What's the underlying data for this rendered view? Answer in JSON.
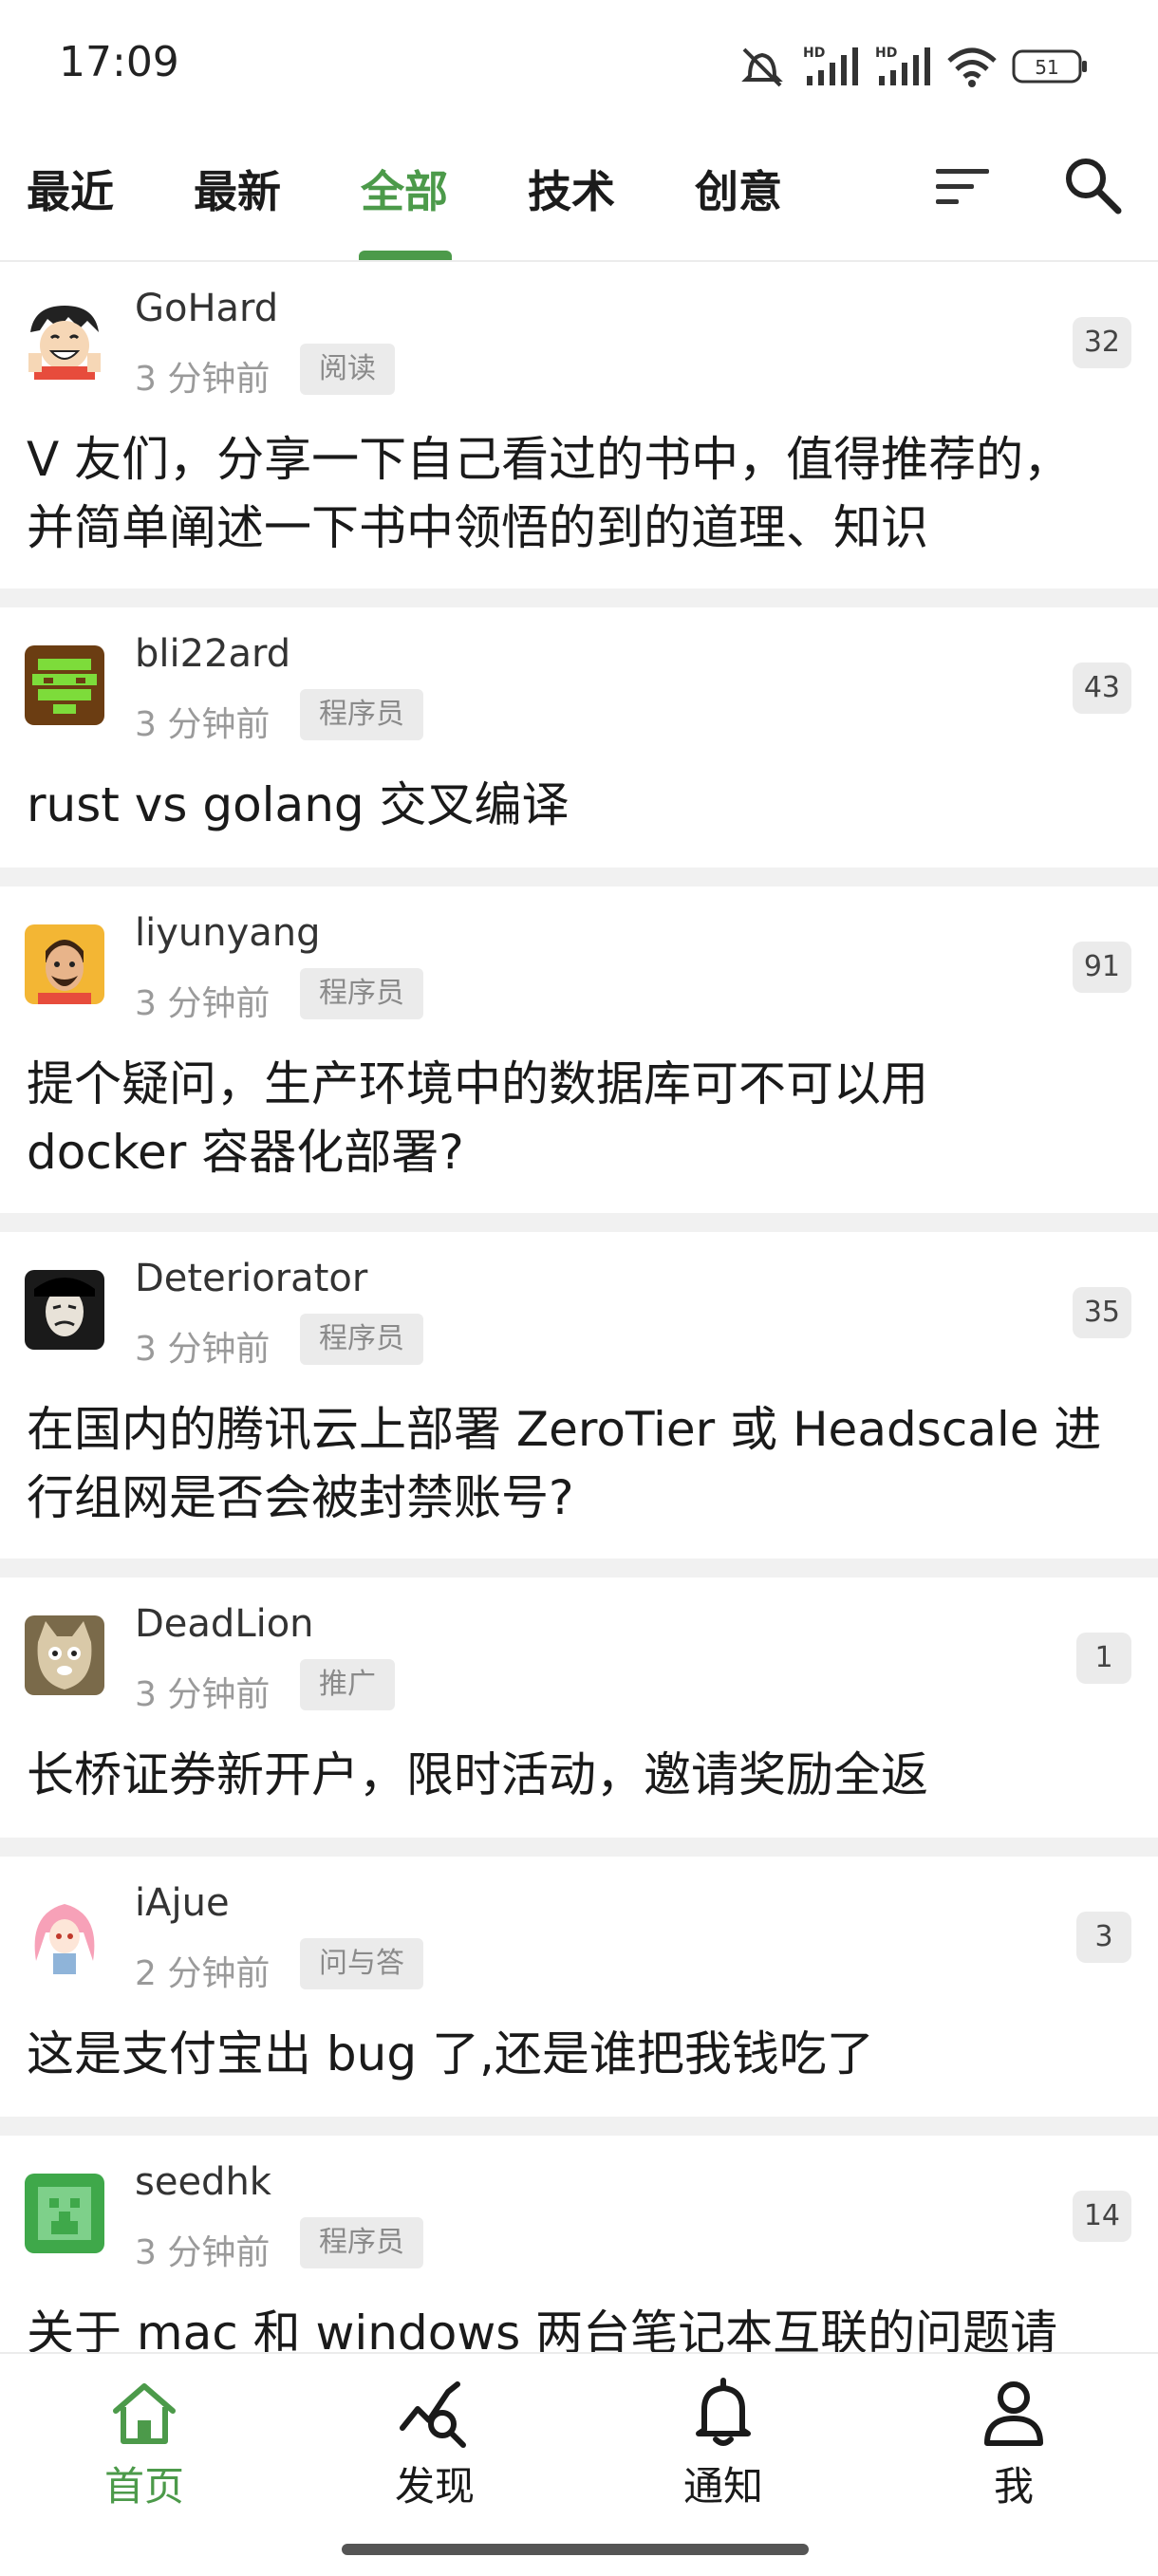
{
  "status_bar": {
    "time": "17:09",
    "battery": "51"
  },
  "tabs": [
    {
      "label": "最近",
      "active": false
    },
    {
      "label": "最新",
      "active": false
    },
    {
      "label": "全部",
      "active": true
    },
    {
      "label": "技术",
      "active": false
    },
    {
      "label": "创意",
      "active": false
    }
  ],
  "header_icons": {
    "sort": "sort-icon",
    "search": "search-icon"
  },
  "topics": [
    {
      "username": "GoHard",
      "time": "3 分钟前",
      "node": "阅读",
      "replies": "32",
      "title_lines": [
        "V 友们，分享一下自己看过的书中，值得推荐的，",
        "并简单阐述一下书中领悟的到的道理、知识"
      ]
    },
    {
      "username": "bli22ard",
      "time": "3 分钟前",
      "node": "程序员",
      "replies": "43",
      "title_lines": [
        "rust vs golang 交叉编译"
      ]
    },
    {
      "username": "liyunyang",
      "time": "3 分钟前",
      "node": "程序员",
      "replies": "91",
      "title_lines": [
        "提个疑问，生产环境中的数据库可不可以用",
        "docker 容器化部署?"
      ]
    },
    {
      "username": "Deteriorator",
      "time": "3 分钟前",
      "node": "程序员",
      "replies": "35",
      "title_lines": [
        "在国内的腾讯云上部署 ZeroTier 或 Headscale 进",
        "行组网是否会被封禁账号?"
      ]
    },
    {
      "username": "DeadLion",
      "time": "3 分钟前",
      "node": "推广",
      "replies": "1",
      "title_lines": [
        "长桥证券新开户，限时活动，邀请奖励全返"
      ]
    },
    {
      "username": "iAjue",
      "time": "2 分钟前",
      "node": "问与答",
      "replies": "3",
      "title_lines": [
        "这是支付宝出 bug 了,还是谁把我钱吃了"
      ]
    },
    {
      "username": "seedhk",
      "time": "3 分钟前",
      "node": "程序员",
      "replies": "14",
      "title_lines": [
        "关于 mac 和 windows 两台笔记本互联的问题请"
      ]
    }
  ],
  "bottom_nav": [
    {
      "label": "首页",
      "icon": "home-icon",
      "active": true
    },
    {
      "label": "发现",
      "icon": "discover-icon",
      "active": false
    },
    {
      "label": "通知",
      "icon": "bell-icon",
      "active": false
    },
    {
      "label": "我",
      "icon": "person-icon",
      "active": false
    }
  ],
  "colors": {
    "accent": "#4c9a4a",
    "divider": "#f1f1f1",
    "tag_bg": "#ebebeb"
  }
}
